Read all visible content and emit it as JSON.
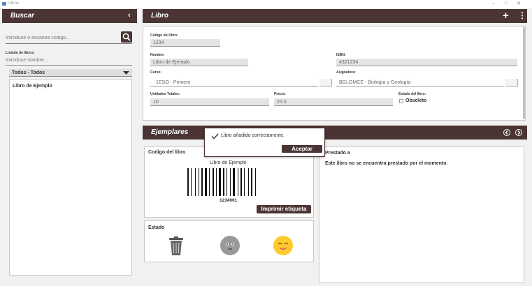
{
  "window": {
    "title": "Libros"
  },
  "search_panel": {
    "title": "Buscar",
    "search_placeholder": "Introduce o escanea codigo...",
    "list_label": "Listado de libros:",
    "name_placeholder": "Introduce nombre...",
    "filter_value": "Todos - Todos",
    "books": [
      "Libro de Ejemplo"
    ]
  },
  "book_panel": {
    "title": "Libro",
    "code_label": "Código del libro:",
    "code_value": "1234",
    "name_label": "Nombre:",
    "name_value": "Libro de Ejemplo",
    "isbn_label": "ISBN:",
    "isbn_value": "4321234",
    "course_label": "Curso:",
    "course_value": "1ESO - Primero",
    "subject_label": "Asignatura:",
    "subject_value": "BGLOMCE - Biología y Geología",
    "units_label": "Unidades Totales:",
    "units_value": "10",
    "price_label": "Precio:",
    "price_value": "25.0",
    "status_label": "Estado del libro:",
    "obsolete_label": "Obsoleto"
  },
  "copies_panel": {
    "title": "Ejemplares",
    "code_section_title": "Codigo del libro",
    "barcode_caption": "Libro de Ejemplo",
    "barcode_number": "1234001",
    "print_label": "Imprimir etiqueta",
    "state_section_title": "Estado",
    "loan_title": "Prestado a",
    "loan_text": "Este libro no se encuentra prestado por el momento."
  },
  "toast": {
    "message": "Libro añadido correctamente.",
    "accept_label": "Aceptar"
  }
}
